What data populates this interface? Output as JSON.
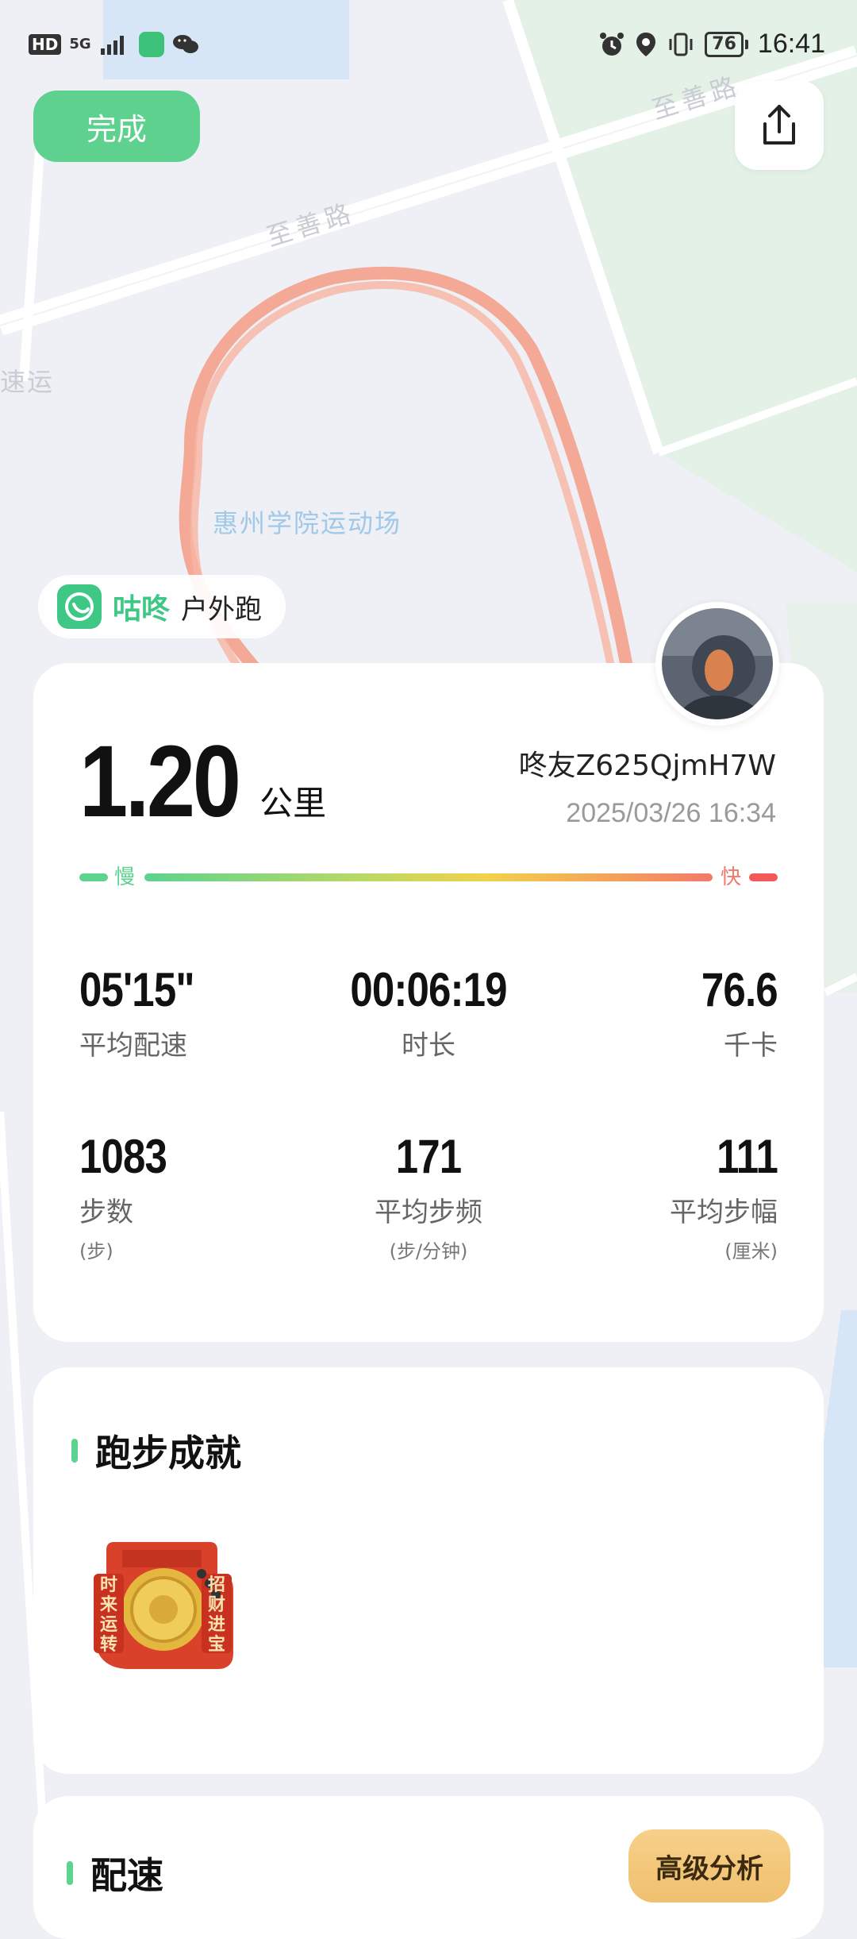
{
  "status_bar": {
    "hd": "HD",
    "network": "5G",
    "battery": "76",
    "time": "16:41"
  },
  "top_bar": {
    "done_label": "完成"
  },
  "map": {
    "road_top_right": "至善路",
    "road_top_left": "至善路",
    "left_label": "速运",
    "place_label": "惠州学院运动场",
    "route_color": "#f4a08c"
  },
  "brand": {
    "name": "咕咚",
    "activity_type": "户外跑"
  },
  "summary": {
    "distance": "1.20",
    "distance_unit": "公里",
    "username": "咚友Z625QjmH7W",
    "datetime": "2025/03/26 16:34",
    "pace_slow_label": "慢",
    "pace_fast_label": "快"
  },
  "stats": [
    {
      "value": "05'15\"",
      "label": "平均配速",
      "unit": ""
    },
    {
      "value": "00:06:19",
      "label": "时长",
      "unit": ""
    },
    {
      "value": "76.6",
      "label": "千卡",
      "unit": ""
    },
    {
      "value": "1083",
      "label": "步数",
      "unit": "(步)"
    },
    {
      "value": "171",
      "label": "平均步频",
      "unit": "(步/分钟)"
    },
    {
      "value": "111",
      "label": "平均步幅",
      "unit": "(厘米)"
    }
  ],
  "achievements": {
    "title": "跑步成就",
    "medal_left_text": "时来运转",
    "medal_right_text": "招财进宝"
  },
  "pace_section": {
    "title": "配速",
    "advanced_button": "高级分析"
  },
  "colors": {
    "accent_green": "#5fd18f",
    "brand_green": "#3fc785",
    "pace_fast_red": "#f25a5a",
    "advanced_gold": "#f0c06f"
  }
}
